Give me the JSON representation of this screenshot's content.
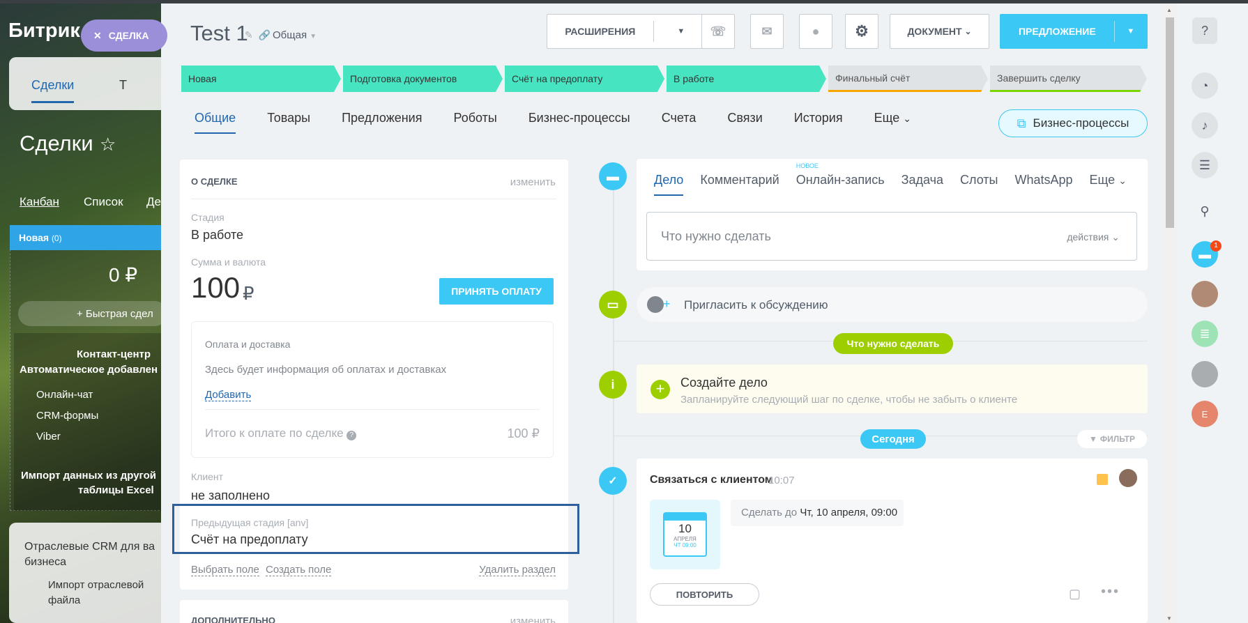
{
  "background": {
    "app_title": "Битрик",
    "tab_deals": "Сделки",
    "tab_t": "Т",
    "page_title": "Сделки",
    "view_kanban": "Канбан",
    "view_list": "Список",
    "view_de": "Де",
    "column_name": "Новая",
    "column_count": "(0)",
    "column_sum": "0 ₽",
    "quick_deal": "+ Быстрая сдел",
    "cc_title": "Контакт-центр",
    "cc_sub": "Автоматическое добавлен",
    "cc_items": [
      "Онлайн-чат",
      "CRM-формы",
      "Viber"
    ],
    "import_text": "Импорт данных из другой",
    "import_text2": "таблицы Excel",
    "industry_title": "Отраслевые CRM для ва",
    "industry_title2": "бизнеса",
    "industry_item": "Импорт отраслевой",
    "industry_item2": "файла"
  },
  "close_label": "СДЕЛКА",
  "header": {
    "title": "Test 1",
    "category": "Общая",
    "btn_extensions": "РАСШИРЕНИЯ",
    "btn_document": "ДОКУМЕНТ",
    "btn_proposal": "ПРЕДЛОЖЕНИЕ"
  },
  "stages": [
    {
      "label": "Новая",
      "w": 198
    },
    {
      "label": "Подготовка документов",
      "w": 200
    },
    {
      "label": "Счёт на предоплату",
      "w": 200
    },
    {
      "label": "В работе",
      "w": 200
    },
    {
      "label": "Финальный счёт",
      "w": 200
    },
    {
      "label": "Завершить сделку",
      "w": 200
    }
  ],
  "tabs": [
    "Общие",
    "Товары",
    "Предложения",
    "Роботы",
    "Бизнес-процессы",
    "Счета",
    "Связи",
    "История",
    "Еще"
  ],
  "bp_button": "Бизнес-процессы",
  "about": {
    "section": "О СДЕЛКЕ",
    "edit": "изменить",
    "stage_label": "Стадия",
    "stage_value": "В работе",
    "sum_label": "Сумма и валюта",
    "sum_value": "100",
    "currency": "₽",
    "pay_button": "ПРИНЯТЬ ОПЛАТУ",
    "payment_title": "Оплата и доставка",
    "payment_info": "Здесь будет информация об оплатах и доставках",
    "add_link": "Добавить",
    "total_label": "Итого к оплате по сделке",
    "total_value": "100 ₽",
    "client_label": "Клиент",
    "client_value": "не заполнено",
    "prev_stage_label": "Предыдущая стадия [anv]",
    "prev_stage_value": "Счёт на предоплату",
    "select_field": "Выбрать поле",
    "create_field": "Создать поле",
    "delete_section": "Удалить раздел",
    "extra_section": "ДОПОЛНИТЕЛЬНО",
    "extra_edit": "изменить"
  },
  "activity": {
    "tabs": [
      "Дело",
      "Комментарий",
      "Онлайн-запись",
      "Задача",
      "Слоты",
      "WhatsApp",
      "Еще"
    ],
    "new_badge": "НОВОЕ",
    "todo_placeholder": "Что нужно сделать",
    "actions": "действия",
    "invite": "Пригласить к обсуждению",
    "todo_pill": "Что нужно сделать",
    "create_title": "Создайте дело",
    "create_sub": "Запланируйте следующий шаг по сделке, чтобы не забыть о клиенте",
    "today": "Сегодня",
    "filter": "ФИЛЬТР",
    "task_title": "Связаться с клиентом",
    "task_time": "10:07",
    "cal_day": "10",
    "cal_month": "АПРЕЛЯ",
    "cal_weekday": "ЧТ 09:00",
    "deadline_label": "Сделать до",
    "deadline_value": "Чт, 10 апреля, 09:00",
    "repeat": "ПОВТОРИТЬ"
  },
  "right": {
    "badge": "1",
    "avatar_letter": "E"
  },
  "colors": {
    "accent": "#3bc8f5",
    "stage_active": "#47e4c2",
    "link": "#2067b0",
    "green": "#9dcf00"
  }
}
